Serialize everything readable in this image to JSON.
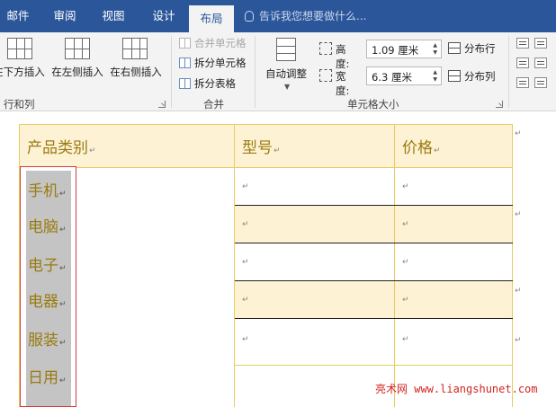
{
  "tabs": [
    "邮件",
    "审阅",
    "视图",
    "设计",
    "布局"
  ],
  "tell_me": "告诉我您想要做什么...",
  "ribbon": {
    "rows_cols": {
      "group_label": "行和列",
      "insert_below": "在下方插入",
      "insert_left": "在左侧插入",
      "insert_right": "在右侧插入"
    },
    "merge": {
      "group_label": "合并",
      "merge_cells": "合并单元格",
      "split_cells": "拆分单元格",
      "split_table": "拆分表格"
    },
    "cell_size": {
      "group_label": "单元格大小",
      "autofit": "自动调整",
      "height_label": "高度:",
      "height_value": "1.09 厘米",
      "width_label": "宽度:",
      "width_value": "6.3 厘米",
      "distribute_rows": "分布行",
      "distribute_cols": "分布列"
    }
  },
  "table": {
    "headers": [
      "产品类别",
      "型号",
      "价格"
    ],
    "categories": [
      "手机",
      "电脑",
      "电子",
      "电器",
      "服装",
      "日用"
    ],
    "mark": "↵"
  },
  "para_mark": "¶",
  "watermark": "亮术网 www.liangshunet.com",
  "colors": {
    "tab_bar": "#2b579a",
    "header_fill": "#fdf2d4",
    "table_text": "#9a7b10",
    "selection": "#c4c4c4",
    "watermark": "#d1261f"
  }
}
